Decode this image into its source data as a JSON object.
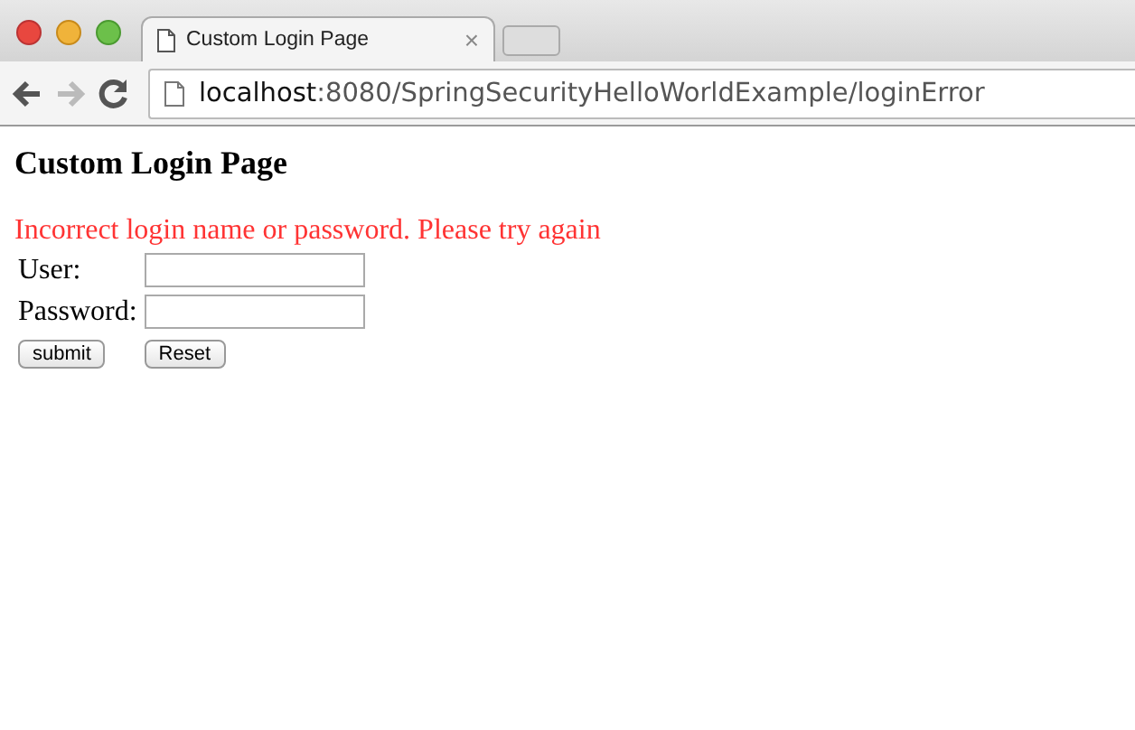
{
  "browser": {
    "tab": {
      "title": "Custom Login Page",
      "close": "×"
    },
    "nav_buttons": [
      {
        "kind": "back",
        "disabled": false
      },
      {
        "kind": "forward",
        "disabled": true
      },
      {
        "kind": "reload",
        "disabled": false
      }
    ],
    "address": {
      "host": "localhost",
      "path": ":8080/SpringSecurityHelloWorldExample/loginError"
    }
  },
  "page": {
    "heading": "Custom Login Page",
    "error": "Incorrect login name or password. Please try again",
    "fields": [
      {
        "label": "User:"
      },
      {
        "label": "Password:"
      }
    ],
    "buttons": [
      "submit",
      "Reset"
    ]
  }
}
